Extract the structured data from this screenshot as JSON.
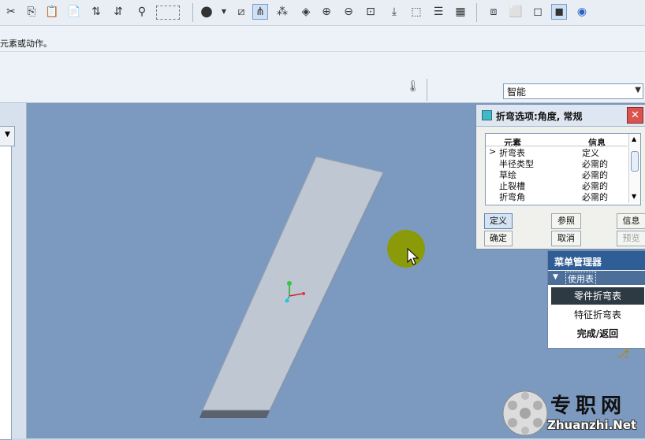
{
  "toolbar": {
    "icons": [
      "scissors-icon",
      "copy-icon",
      "paste-icon",
      "paste-special-icon",
      "regenerate-icon",
      "regen-manager-icon",
      "find-icon",
      "select-box-icon",
      "display-style-icon",
      "datum-plane-icon",
      "datum-axis-icon",
      "datum-point-icon",
      "spin-center-icon",
      "zoom-in-icon",
      "zoom-out-icon",
      "refit-icon",
      "reorient-icon",
      "annotation-icon",
      "layers-icon",
      "view-manager-icon",
      "wireframe-icon",
      "hidden-line-icon",
      "no-hidden-icon",
      "shading-icon",
      "model-tree-icon"
    ]
  },
  "message": {
    "text": "元素或动作。"
  },
  "filter": {
    "value": "智能"
  },
  "bend_dialog": {
    "title": "折弯选项:角度, 常规",
    "col_element": "元素",
    "col_info": "信息",
    "rows": [
      {
        "marker": ">",
        "element": "折弯表",
        "info": "定义"
      },
      {
        "marker": "",
        "element": "半径类型",
        "info": "必需的"
      },
      {
        "marker": "",
        "element": "草绘",
        "info": "必需的"
      },
      {
        "marker": "",
        "element": "止裂槽",
        "info": "必需的"
      },
      {
        "marker": "",
        "element": "折弯角",
        "info": "必需的"
      }
    ],
    "btn_define": "定义",
    "btn_refs": "参照",
    "btn_info": "信息",
    "btn_ok": "确定",
    "btn_cancel": "取消",
    "btn_preview": "预览"
  },
  "menu_manager": {
    "title": "菜单管理器",
    "submenu": "使用表",
    "items": [
      "零件折弯表",
      "特征折弯表",
      "完成/返回"
    ]
  },
  "watermark": {
    "chinese": "专职网",
    "url": "Zhuanzhi.Net"
  },
  "colors": {
    "viewport": "#7c9ac0",
    "plate_top": "#bfc7d3",
    "plate_side": "#5a6270",
    "cursor_highlight": "#8a9a08",
    "menu_title": "#2f5e97",
    "menu_selected": "#2d3a44"
  }
}
